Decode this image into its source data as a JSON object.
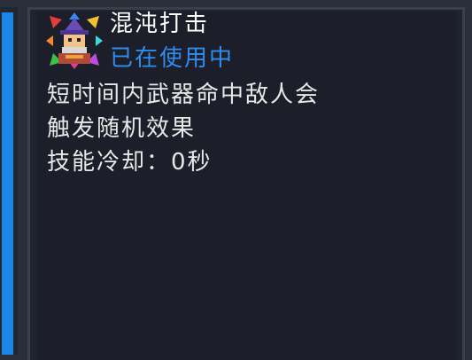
{
  "skill": {
    "name": "混沌打击",
    "status": "已在使用中",
    "description_lines": [
      "短时间内武器命中敌人会",
      "触发随机效果"
    ],
    "cooldown_label": "技能冷却：",
    "cooldown_value": "0秒",
    "icon": "chaos-strike-skill-icon"
  },
  "colors": {
    "status_text": "#2f8cf0",
    "side_bar": "#1a86e8",
    "panel_bg": "#1c1f29"
  }
}
